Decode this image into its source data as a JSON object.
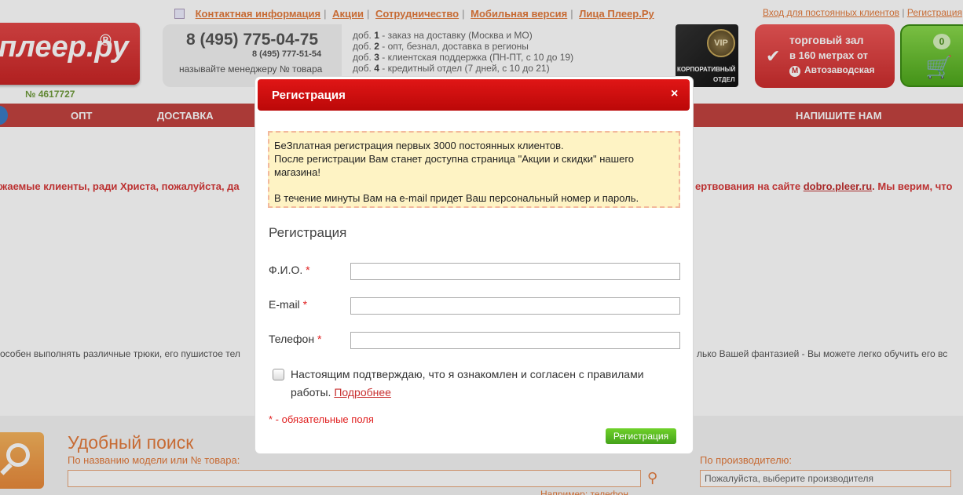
{
  "header": {
    "top_links": [
      "Контактная информация",
      "Акции",
      "Сотрудничество",
      "Мобильная версия",
      "Лица Плеер.Ру"
    ],
    "login_link": "Вход для постоянных клиентов",
    "login_sep": "|",
    "register_link": "Регистрация",
    "logo_text": "плеер.ру",
    "logo_reg": "®",
    "logo_number": "№ 4617727",
    "phone_main": "8 (495) 775-04-75",
    "phone_sub": "8 (495) 777-51-54",
    "phone_note": "называйте менеджеру № товара",
    "extensions": [
      {
        "prefix": "доб. ",
        "num": "1",
        "text": " - заказ на доставку (Москва и МО)"
      },
      {
        "prefix": "доб. ",
        "num": "2",
        "text": " - опт, безнал, доставка в регионы"
      },
      {
        "prefix": "доб. ",
        "num": "3",
        "text": " - клиентская поддержка (ПН-ПТ, с 10 до 19)"
      },
      {
        "prefix": "доб. ",
        "num": "4",
        "text": " - кредитный отдел (7 дней, с 10 до 21)"
      }
    ],
    "vip_badge": "VIP",
    "vip_line1": "КОРПОРАТИВНЫЙ",
    "vip_line2": "ОТДЕЛ",
    "hall_line1": "торговый зал",
    "hall_line2": "в 160 метрах от",
    "hall_metro_icon": "М",
    "hall_metro": "Автозаводская",
    "hall_check": "✔",
    "cart_count": "0",
    "cart_icon": "🛒"
  },
  "nav": {
    "items": [
      "ОПТ",
      "ДОСТАВКА",
      "НАПИШИТЕ НАМ"
    ]
  },
  "notice": {
    "left": "жаемые клиенты, ради Христа, пожалуйста, да",
    "right_text": "ертвования на сайте ",
    "right_link": "dobro.pleer.ru",
    "right_tail": ". Мы верим, что"
  },
  "description": {
    "left": "особен выполнять различные трюки, его пушистое тел",
    "right": "лько Вашей фантазией - Вы можете легко обучить его вс"
  },
  "search": {
    "title": "Удобный поиск",
    "subtitle": "По названию модели или № товара:",
    "search_button_icon": "⚲",
    "example": "Например: телефон",
    "manufacturer_label": "По производителю:",
    "manufacturer_value": "Пожалуйста, выберите производителя"
  },
  "modal": {
    "title": "Регистрация",
    "close_icon": "×",
    "info_line1": "БеЗплатная регистрация первых 3000 постоянных клиентов.",
    "info_line2": "После регистрации Вам станет доступна страница \"Акции и скидки\" нашего магазина!",
    "info_line3": "В течение минуты Вам на e-mail придет Ваш персональный номер и пароль.",
    "form_title": "Регистрация",
    "fields": [
      {
        "label": "Ф.И.О.",
        "required": "*",
        "value": ""
      },
      {
        "label": "E-mail",
        "required": "*",
        "value": ""
      },
      {
        "label": "Телефон",
        "required": "*",
        "value": ""
      }
    ],
    "agree_text": "Настоящим подтверждаю, что я ознакомлен и согласен с правилами работы.",
    "agree_link": "Подробнее",
    "required_note": "* - обязательные поля",
    "submit_label": "Регистрация"
  },
  "colors": {
    "brand_red": "#c2433f",
    "modal_header": "#cc0e0e",
    "accent_orange": "#e37a3c",
    "submit_green": "#55b91f",
    "info_bg": "#fef3c4"
  }
}
